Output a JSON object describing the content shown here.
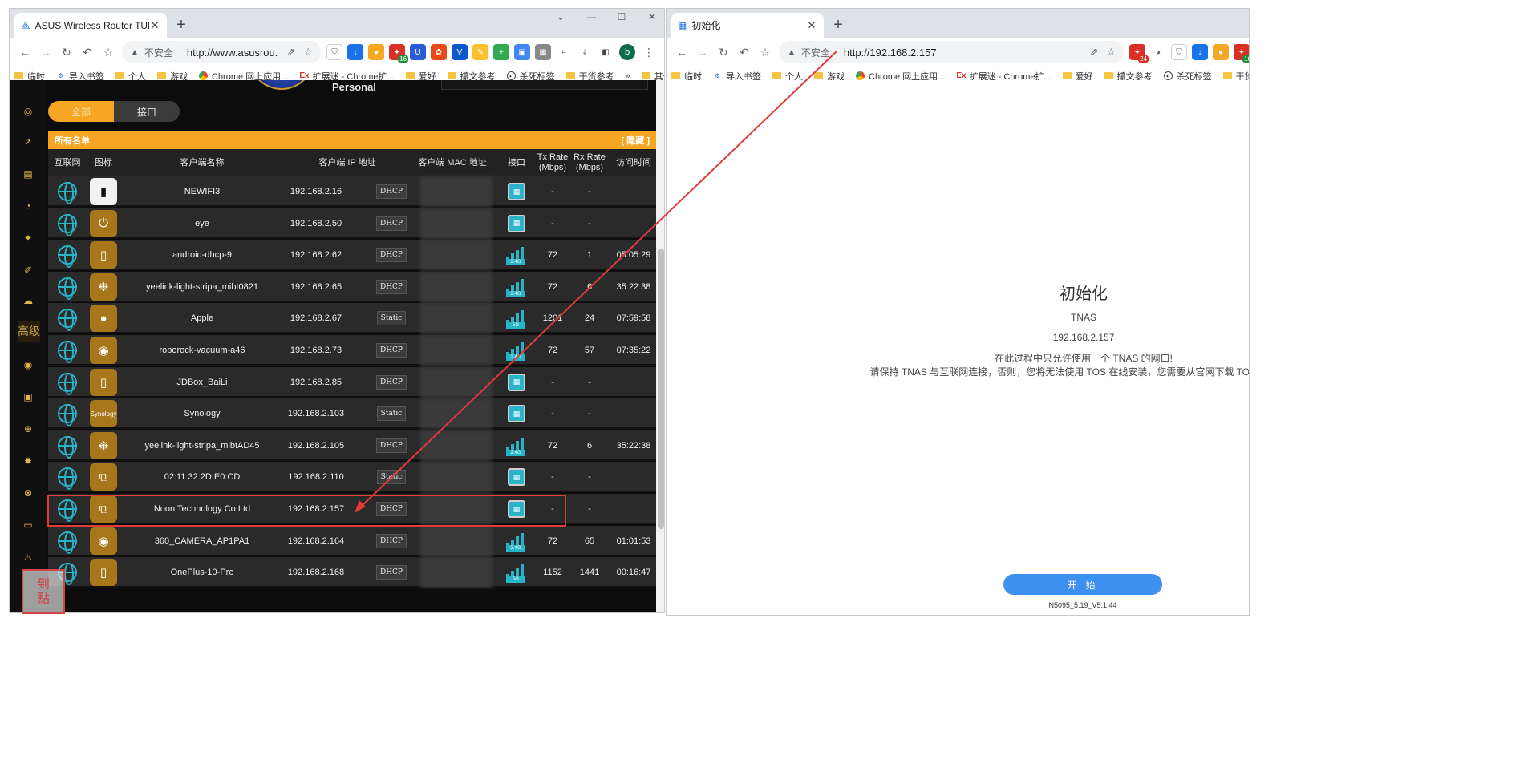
{
  "left_window": {
    "tab_title": "ASUS Wireless Router TUF GA",
    "url": "http://www.asusrou...",
    "insecure": "不安全",
    "window_controls": [
      "⌄",
      "—",
      "☐",
      "✕"
    ],
    "bookmarks": [
      "临时",
      "导入书签",
      "个人",
      "游戏",
      "Chrome 网上应用...",
      "扩展迷 - Chrome扩...",
      "爱好",
      "攥文参考",
      "杀死标签",
      "干货参考",
      "»",
      "其他书签"
    ],
    "avatar_letter": "b",
    "ext_badge": "16"
  },
  "right_window": {
    "tab_title": "初始化",
    "url": "http://192.168.2.157",
    "insecure": "不安全",
    "bookmarks": [
      "临时",
      "导入书签",
      "个人",
      "游戏",
      "Chrome 网上应用...",
      "扩展迷 - Chrome扩...",
      "爱好",
      "攥文参考",
      "杀死标签",
      "干货参考"
    ],
    "ext_badges": [
      "24",
      "16"
    ]
  },
  "router": {
    "persona": "Personal",
    "toggle": {
      "all": "全部",
      "iface": "接口"
    },
    "list_title": "所有名单",
    "hide": "[ 隐藏 ]",
    "side_label": "高级",
    "columns": [
      "互联网",
      "图标",
      "客户端名称",
      "客户端 IP 地址",
      "客户端 MAC 地址",
      "接口",
      "Tx Rate\n(Mbps)",
      "Rx Rate\n(Mbps)",
      "访问时间"
    ],
    "clients": [
      {
        "name": "NEWIFI3",
        "ip": "192.168.2.16",
        "type": "DHCP",
        "iface": "lan",
        "tx": "-",
        "rx": "-",
        "time": "",
        "icon": "router-icon",
        "glyph": "▮",
        "white": true
      },
      {
        "name": "eye",
        "ip": "192.168.2.50",
        "type": "DHCP",
        "iface": "lan",
        "tx": "-",
        "rx": "-",
        "time": "",
        "icon": "monitor-icon",
        "glyph": "⏻"
      },
      {
        "name": "android-dhcp-9",
        "ip": "192.168.2.62",
        "type": "DHCP",
        "iface": "2.4G",
        "tx": "72",
        "rx": "1",
        "time": "05:05:29",
        "icon": "phone-icon",
        "glyph": "▯"
      },
      {
        "name": "yeelink-light-stripa_mibt0821",
        "ip": "192.168.2.65",
        "type": "DHCP",
        "iface": "2.4G",
        "tx": "72",
        "rx": "6",
        "time": "35:22:38",
        "icon": "smart-bulb-icon",
        "glyph": "❉"
      },
      {
        "name": "Apple",
        "ip": "192.168.2.67",
        "type": "Static",
        "iface": "5G",
        "tx": "1201",
        "rx": "24",
        "time": "07:59:58",
        "icon": "apple-icon",
        "glyph": "●"
      },
      {
        "name": "roborock-vacuum-a46",
        "ip": "192.168.2.73",
        "type": "DHCP",
        "iface": "2.4G",
        "tx": "72",
        "rx": "57",
        "time": "07:35:22",
        "icon": "camera-icon",
        "glyph": "◉"
      },
      {
        "name": "JDBox_BaiLi",
        "ip": "192.168.2.85",
        "type": "DHCP",
        "iface": "lan",
        "tx": "-",
        "rx": "-",
        "time": "",
        "icon": "phone-icon",
        "glyph": "▯"
      },
      {
        "name": "Synology",
        "ip": "192.168.2.103",
        "type": "Static",
        "iface": "lan",
        "tx": "-",
        "rx": "-",
        "time": "",
        "icon": "synology-icon",
        "glyph": "Synology"
      },
      {
        "name": "yeelink-light-stripa_mibtAD45",
        "ip": "192.168.2.105",
        "type": "DHCP",
        "iface": "2.4G",
        "tx": "72",
        "rx": "6",
        "time": "35:22:38",
        "icon": "smart-bulb-icon",
        "glyph": "❉"
      },
      {
        "name": "02:11:32:2D:E0:CD",
        "ip": "192.168.2.110",
        "type": "Static",
        "iface": "lan",
        "tx": "-",
        "rx": "-",
        "time": "",
        "icon": "devices-icon",
        "glyph": "⧉"
      },
      {
        "name": "Noon Technology Co Ltd",
        "ip": "192.168.2.157",
        "type": "DHCP",
        "iface": "lan",
        "tx": "-",
        "rx": "-",
        "time": "",
        "icon": "devices-icon",
        "glyph": "⧉"
      },
      {
        "name": "360_CAMERA_AP1PA1",
        "ip": "192.168.2.164",
        "type": "DHCP",
        "iface": "2.4G",
        "tx": "72",
        "rx": "65",
        "time": "01:01:53",
        "icon": "camera-icon",
        "glyph": "◉"
      },
      {
        "name": "OnePlus-10-Pro",
        "ip": "192.168.2.168",
        "type": "DHCP",
        "iface": "5G",
        "tx": "1152",
        "rx": "1441",
        "time": "00:16:47",
        "icon": "phone-icon",
        "glyph": "▯"
      }
    ]
  },
  "tnas": {
    "title": "初始化",
    "name": "TNAS",
    "ip": "192.168.2.157",
    "note1": "在此过程中只允许使用一个 TNAS 的网口!",
    "note2": "请保持 TNAS 与互联网连接，否则，您将无法使用 TOS 在线安装，您需要从官网下载 TOS 安装包然",
    "start": "开 始",
    "version": "N5095_5.19_V5.1.44"
  },
  "seal_text": "到\n點"
}
